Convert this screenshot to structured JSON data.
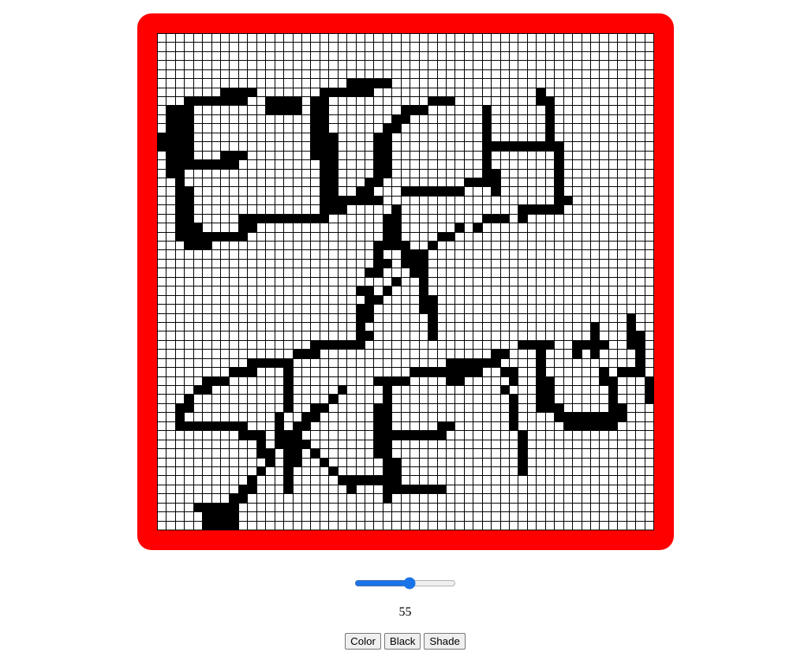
{
  "canvas": {
    "frame_color": "#ff0000",
    "grid_size": 55,
    "fill_color": "#000000",
    "filled_cells": [
      [
        5,
        21
      ],
      [
        5,
        22
      ],
      [
        5,
        23
      ],
      [
        5,
        24
      ],
      [
        5,
        25
      ],
      [
        6,
        7
      ],
      [
        6,
        8
      ],
      [
        6,
        9
      ],
      [
        6,
        10
      ],
      [
        6,
        18
      ],
      [
        6,
        19
      ],
      [
        6,
        20
      ],
      [
        6,
        21
      ],
      [
        6,
        22
      ],
      [
        6,
        23
      ],
      [
        6,
        42
      ],
      [
        7,
        3
      ],
      [
        7,
        4
      ],
      [
        7,
        5
      ],
      [
        7,
        6
      ],
      [
        7,
        7
      ],
      [
        7,
        8
      ],
      [
        7,
        9
      ],
      [
        7,
        12
      ],
      [
        7,
        13
      ],
      [
        7,
        14
      ],
      [
        7,
        15
      ],
      [
        7,
        17
      ],
      [
        7,
        18
      ],
      [
        7,
        30
      ],
      [
        7,
        31
      ],
      [
        7,
        32
      ],
      [
        7,
        42
      ],
      [
        7,
        43
      ],
      [
        8,
        1
      ],
      [
        8,
        2
      ],
      [
        8,
        3
      ],
      [
        8,
        12
      ],
      [
        8,
        13
      ],
      [
        8,
        14
      ],
      [
        8,
        15
      ],
      [
        8,
        17
      ],
      [
        8,
        18
      ],
      [
        8,
        27
      ],
      [
        8,
        28
      ],
      [
        8,
        29
      ],
      [
        8,
        36
      ],
      [
        8,
        43
      ],
      [
        9,
        1
      ],
      [
        9,
        2
      ],
      [
        9,
        3
      ],
      [
        9,
        17
      ],
      [
        9,
        18
      ],
      [
        9,
        26
      ],
      [
        9,
        27
      ],
      [
        9,
        36
      ],
      [
        9,
        43
      ],
      [
        10,
        1
      ],
      [
        10,
        2
      ],
      [
        10,
        3
      ],
      [
        10,
        17
      ],
      [
        10,
        18
      ],
      [
        10,
        25
      ],
      [
        10,
        26
      ],
      [
        10,
        36
      ],
      [
        10,
        43
      ],
      [
        11,
        0
      ],
      [
        11,
        1
      ],
      [
        11,
        2
      ],
      [
        11,
        3
      ],
      [
        11,
        17
      ],
      [
        11,
        18
      ],
      [
        11,
        19
      ],
      [
        11,
        24
      ],
      [
        11,
        25
      ],
      [
        11,
        36
      ],
      [
        11,
        43
      ],
      [
        12,
        0
      ],
      [
        12,
        1
      ],
      [
        12,
        2
      ],
      [
        12,
        3
      ],
      [
        12,
        17
      ],
      [
        12,
        18
      ],
      [
        12,
        19
      ],
      [
        12,
        24
      ],
      [
        12,
        25
      ],
      [
        12,
        36
      ],
      [
        12,
        37
      ],
      [
        12,
        38
      ],
      [
        12,
        39
      ],
      [
        12,
        40
      ],
      [
        12,
        41
      ],
      [
        12,
        42
      ],
      [
        12,
        43
      ],
      [
        12,
        44
      ],
      [
        13,
        1
      ],
      [
        13,
        2
      ],
      [
        13,
        3
      ],
      [
        13,
        7
      ],
      [
        13,
        8
      ],
      [
        13,
        9
      ],
      [
        13,
        17
      ],
      [
        13,
        18
      ],
      [
        13,
        19
      ],
      [
        13,
        24
      ],
      [
        13,
        25
      ],
      [
        13,
        36
      ],
      [
        13,
        44
      ],
      [
        14,
        1
      ],
      [
        14,
        2
      ],
      [
        14,
        3
      ],
      [
        14,
        4
      ],
      [
        14,
        5
      ],
      [
        14,
        6
      ],
      [
        14,
        7
      ],
      [
        14,
        8
      ],
      [
        14,
        18
      ],
      [
        14,
        19
      ],
      [
        14,
        24
      ],
      [
        14,
        25
      ],
      [
        14,
        36
      ],
      [
        14,
        44
      ],
      [
        15,
        1
      ],
      [
        15,
        2
      ],
      [
        15,
        18
      ],
      [
        15,
        19
      ],
      [
        15,
        24
      ],
      [
        15,
        25
      ],
      [
        15,
        36
      ],
      [
        15,
        37
      ],
      [
        15,
        44
      ],
      [
        16,
        2
      ],
      [
        16,
        18
      ],
      [
        16,
        19
      ],
      [
        16,
        23
      ],
      [
        16,
        24
      ],
      [
        16,
        34
      ],
      [
        16,
        35
      ],
      [
        16,
        36
      ],
      [
        16,
        37
      ],
      [
        16,
        44
      ],
      [
        17,
        2
      ],
      [
        17,
        3
      ],
      [
        17,
        18
      ],
      [
        17,
        19
      ],
      [
        17,
        22
      ],
      [
        17,
        23
      ],
      [
        17,
        27
      ],
      [
        17,
        28
      ],
      [
        17,
        29
      ],
      [
        17,
        30
      ],
      [
        17,
        31
      ],
      [
        17,
        32
      ],
      [
        17,
        33
      ],
      [
        17,
        37
      ],
      [
        17,
        44
      ],
      [
        18,
        2
      ],
      [
        18,
        3
      ],
      [
        18,
        18
      ],
      [
        18,
        19
      ],
      [
        18,
        20
      ],
      [
        18,
        21
      ],
      [
        18,
        22
      ],
      [
        18,
        23
      ],
      [
        18,
        24
      ],
      [
        18,
        44
      ],
      [
        18,
        45
      ],
      [
        19,
        2
      ],
      [
        19,
        3
      ],
      [
        19,
        18
      ],
      [
        19,
        19
      ],
      [
        19,
        20
      ],
      [
        19,
        26
      ],
      [
        19,
        40
      ],
      [
        19,
        41
      ],
      [
        19,
        42
      ],
      [
        19,
        43
      ],
      [
        19,
        44
      ],
      [
        20,
        2
      ],
      [
        20,
        3
      ],
      [
        20,
        9
      ],
      [
        20,
        10
      ],
      [
        20,
        11
      ],
      [
        20,
        12
      ],
      [
        20,
        13
      ],
      [
        20,
        14
      ],
      [
        20,
        15
      ],
      [
        20,
        16
      ],
      [
        20,
        17
      ],
      [
        20,
        18
      ],
      [
        20,
        25
      ],
      [
        20,
        26
      ],
      [
        20,
        36
      ],
      [
        20,
        37
      ],
      [
        20,
        38
      ],
      [
        20,
        40
      ],
      [
        21,
        2
      ],
      [
        21,
        3
      ],
      [
        21,
        4
      ],
      [
        21,
        9
      ],
      [
        21,
        10
      ],
      [
        21,
        25
      ],
      [
        21,
        26
      ],
      [
        21,
        33
      ],
      [
        21,
        35
      ],
      [
        22,
        2
      ],
      [
        22,
        3
      ],
      [
        22,
        4
      ],
      [
        22,
        5
      ],
      [
        22,
        6
      ],
      [
        22,
        7
      ],
      [
        22,
        8
      ],
      [
        22,
        9
      ],
      [
        22,
        25
      ],
      [
        22,
        26
      ],
      [
        22,
        31
      ],
      [
        22,
        32
      ],
      [
        23,
        3
      ],
      [
        23,
        4
      ],
      [
        23,
        5
      ],
      [
        23,
        24
      ],
      [
        23,
        25
      ],
      [
        23,
        26
      ],
      [
        23,
        27
      ],
      [
        23,
        30
      ],
      [
        24,
        24
      ],
      [
        24,
        27
      ],
      [
        24,
        28
      ],
      [
        24,
        29
      ],
      [
        25,
        24
      ],
      [
        25,
        25
      ],
      [
        25,
        27
      ],
      [
        25,
        28
      ],
      [
        25,
        29
      ],
      [
        26,
        23
      ],
      [
        26,
        24
      ],
      [
        26,
        28
      ],
      [
        26,
        29
      ],
      [
        27,
        26
      ],
      [
        27,
        29
      ],
      [
        28,
        22
      ],
      [
        28,
        23
      ],
      [
        28,
        25
      ],
      [
        28,
        29
      ],
      [
        29,
        23
      ],
      [
        29,
        24
      ],
      [
        29,
        29
      ],
      [
        29,
        30
      ],
      [
        30,
        22
      ],
      [
        30,
        23
      ],
      [
        30,
        29
      ],
      [
        30,
        30
      ],
      [
        31,
        22
      ],
      [
        31,
        23
      ],
      [
        31,
        30
      ],
      [
        31,
        52
      ],
      [
        32,
        22
      ],
      [
        32,
        30
      ],
      [
        32,
        48
      ],
      [
        32,
        52
      ],
      [
        33,
        22
      ],
      [
        33,
        23
      ],
      [
        33,
        30
      ],
      [
        33,
        48
      ],
      [
        33,
        52
      ],
      [
        33,
        53
      ],
      [
        34,
        17
      ],
      [
        34,
        18
      ],
      [
        34,
        19
      ],
      [
        34,
        20
      ],
      [
        34,
        21
      ],
      [
        34,
        22
      ],
      [
        34,
        40
      ],
      [
        34,
        41
      ],
      [
        34,
        42
      ],
      [
        34,
        43
      ],
      [
        34,
        46
      ],
      [
        34,
        47
      ],
      [
        34,
        48
      ],
      [
        34,
        49
      ],
      [
        34,
        52
      ],
      [
        34,
        53
      ],
      [
        35,
        15
      ],
      [
        35,
        16
      ],
      [
        35,
        17
      ],
      [
        35,
        37
      ],
      [
        35,
        38
      ],
      [
        35,
        42
      ],
      [
        35,
        46
      ],
      [
        35,
        48
      ],
      [
        35,
        53
      ],
      [
        36,
        10
      ],
      [
        36,
        11
      ],
      [
        36,
        12
      ],
      [
        36,
        13
      ],
      [
        36,
        14
      ],
      [
        36,
        32
      ],
      [
        36,
        33
      ],
      [
        36,
        34
      ],
      [
        36,
        35
      ],
      [
        36,
        36
      ],
      [
        36,
        37
      ],
      [
        36,
        42
      ],
      [
        36,
        53
      ],
      [
        37,
        8
      ],
      [
        37,
        9
      ],
      [
        37,
        10
      ],
      [
        37,
        14
      ],
      [
        37,
        28
      ],
      [
        37,
        29
      ],
      [
        37,
        30
      ],
      [
        37,
        31
      ],
      [
        37,
        32
      ],
      [
        37,
        33
      ],
      [
        37,
        34
      ],
      [
        37,
        35
      ],
      [
        37,
        38
      ],
      [
        37,
        39
      ],
      [
        37,
        42
      ],
      [
        37,
        49
      ],
      [
        37,
        51
      ],
      [
        37,
        52
      ],
      [
        37,
        53
      ],
      [
        38,
        5
      ],
      [
        38,
        6
      ],
      [
        38,
        7
      ],
      [
        38,
        14
      ],
      [
        38,
        24
      ],
      [
        38,
        25
      ],
      [
        38,
        26
      ],
      [
        38,
        27
      ],
      [
        38,
        32
      ],
      [
        38,
        33
      ],
      [
        38,
        39
      ],
      [
        38,
        42
      ],
      [
        38,
        43
      ],
      [
        38,
        49
      ],
      [
        38,
        50
      ],
      [
        38,
        54
      ],
      [
        39,
        4
      ],
      [
        39,
        5
      ],
      [
        39,
        14
      ],
      [
        39,
        20
      ],
      [
        39,
        25
      ],
      [
        39,
        38
      ],
      [
        39,
        42
      ],
      [
        39,
        43
      ],
      [
        39,
        50
      ],
      [
        39,
        54
      ],
      [
        40,
        3
      ],
      [
        40,
        14
      ],
      [
        40,
        19
      ],
      [
        40,
        25
      ],
      [
        40,
        39
      ],
      [
        40,
        42
      ],
      [
        40,
        43
      ],
      [
        40,
        50
      ],
      [
        40,
        54
      ],
      [
        41,
        2
      ],
      [
        41,
        3
      ],
      [
        41,
        14
      ],
      [
        41,
        17
      ],
      [
        41,
        18
      ],
      [
        41,
        24
      ],
      [
        41,
        25
      ],
      [
        41,
        39
      ],
      [
        41,
        42
      ],
      [
        41,
        43
      ],
      [
        41,
        44
      ],
      [
        41,
        50
      ],
      [
        41,
        51
      ],
      [
        42,
        2
      ],
      [
        42,
        13
      ],
      [
        42,
        16
      ],
      [
        42,
        17
      ],
      [
        42,
        24
      ],
      [
        42,
        25
      ],
      [
        42,
        39
      ],
      [
        42,
        44
      ],
      [
        42,
        45
      ],
      [
        42,
        46
      ],
      [
        42,
        47
      ],
      [
        42,
        48
      ],
      [
        42,
        49
      ],
      [
        42,
        50
      ],
      [
        42,
        51
      ],
      [
        43,
        2
      ],
      [
        43,
        3
      ],
      [
        43,
        4
      ],
      [
        43,
        5
      ],
      [
        43,
        6
      ],
      [
        43,
        7
      ],
      [
        43,
        8
      ],
      [
        43,
        9
      ],
      [
        43,
        13
      ],
      [
        43,
        15
      ],
      [
        43,
        16
      ],
      [
        43,
        24
      ],
      [
        43,
        25
      ],
      [
        43,
        31
      ],
      [
        43,
        32
      ],
      [
        43,
        39
      ],
      [
        43,
        45
      ],
      [
        43,
        46
      ],
      [
        43,
        47
      ],
      [
        43,
        48
      ],
      [
        43,
        49
      ],
      [
        43,
        50
      ],
      [
        44,
        9
      ],
      [
        44,
        10
      ],
      [
        44,
        11
      ],
      [
        44,
        13
      ],
      [
        44,
        14
      ],
      [
        44,
        15
      ],
      [
        44,
        24
      ],
      [
        44,
        25
      ],
      [
        44,
        26
      ],
      [
        44,
        27
      ],
      [
        44,
        28
      ],
      [
        44,
        29
      ],
      [
        44,
        30
      ],
      [
        44,
        31
      ],
      [
        44,
        40
      ],
      [
        45,
        11
      ],
      [
        45,
        13
      ],
      [
        45,
        14
      ],
      [
        45,
        15
      ],
      [
        45,
        16
      ],
      [
        45,
        24
      ],
      [
        45,
        25
      ],
      [
        45,
        40
      ],
      [
        46,
        11
      ],
      [
        46,
        12
      ],
      [
        46,
        14
      ],
      [
        46,
        15
      ],
      [
        46,
        17
      ],
      [
        46,
        24
      ],
      [
        46,
        25
      ],
      [
        46,
        40
      ],
      [
        47,
        12
      ],
      [
        47,
        14
      ],
      [
        47,
        15
      ],
      [
        47,
        18
      ],
      [
        47,
        25
      ],
      [
        47,
        26
      ],
      [
        47,
        40
      ],
      [
        48,
        11
      ],
      [
        48,
        14
      ],
      [
        48,
        19
      ],
      [
        48,
        25
      ],
      [
        48,
        26
      ],
      [
        48,
        40
      ],
      [
        49,
        10
      ],
      [
        49,
        14
      ],
      [
        49,
        20
      ],
      [
        49,
        21
      ],
      [
        49,
        22
      ],
      [
        49,
        23
      ],
      [
        49,
        24
      ],
      [
        49,
        25
      ],
      [
        49,
        26
      ],
      [
        50,
        9
      ],
      [
        50,
        10
      ],
      [
        50,
        14
      ],
      [
        50,
        21
      ],
      [
        50,
        25
      ],
      [
        50,
        26
      ],
      [
        50,
        27
      ],
      [
        50,
        28
      ],
      [
        50,
        29
      ],
      [
        50,
        30
      ],
      [
        50,
        31
      ],
      [
        51,
        8
      ],
      [
        51,
        9
      ],
      [
        51,
        25
      ],
      [
        52,
        4
      ],
      [
        52,
        5
      ],
      [
        52,
        6
      ],
      [
        52,
        7
      ],
      [
        52,
        8
      ],
      [
        53,
        5
      ],
      [
        53,
        6
      ],
      [
        53,
        7
      ],
      [
        53,
        8
      ],
      [
        54,
        5
      ],
      [
        54,
        6
      ],
      [
        54,
        7
      ],
      [
        54,
        8
      ]
    ]
  },
  "controls": {
    "slider_value": 55,
    "slider_min": 1,
    "slider_max": 100,
    "readout": "55",
    "buttons": {
      "color": "Color",
      "black": "Black",
      "shade": "Shade"
    }
  }
}
